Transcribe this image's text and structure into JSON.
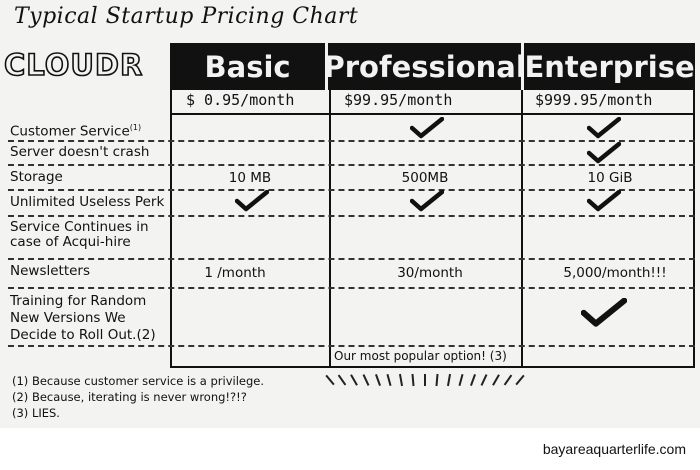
{
  "title": "Typical Startup Pricing Chart",
  "logo": "CLOUDR",
  "plans": [
    {
      "name": "Basic",
      "price": "$ 0.95/month"
    },
    {
      "name": "Professional",
      "price": "$99.95/month"
    },
    {
      "name": "Enterprise",
      "price": "$999.95/month"
    }
  ],
  "features": [
    {
      "label": "Customer Service",
      "note": "(1)"
    },
    {
      "label": "Server doesn't crash"
    },
    {
      "label": "Storage"
    },
    {
      "label": "Unlimited Useless Perk"
    },
    {
      "label": "Service Continues in case of Acqui-hire"
    },
    {
      "label": "Newsletters"
    },
    {
      "label": "Training for Random New Versions We Decide to Roll Out.",
      "note": "(2)"
    }
  ],
  "values": {
    "storage": [
      "10 MB",
      "500MB",
      "10 GiB"
    ],
    "newsletters": [
      "1 /month",
      "30/month",
      "5,000/month!!!"
    ]
  },
  "checks": {
    "customer_service": [
      false,
      true,
      true
    ],
    "server_doesnt_crash": [
      false,
      false,
      true
    ],
    "unlimited_perk": [
      true,
      true,
      true
    ],
    "acqui_hire": [
      false,
      false,
      false
    ],
    "training": [
      false,
      false,
      true
    ]
  },
  "popular_note": "Our most popular option! (3)",
  "footnotes": [
    "(1) Because customer service is a privilege.",
    "(2) Because, iterating is never wrong!?!?",
    "(3) LIES."
  ],
  "site": "bayareaquarterlife.com",
  "colors": {
    "ink": "#111111",
    "paper": "#f3f3f1"
  }
}
